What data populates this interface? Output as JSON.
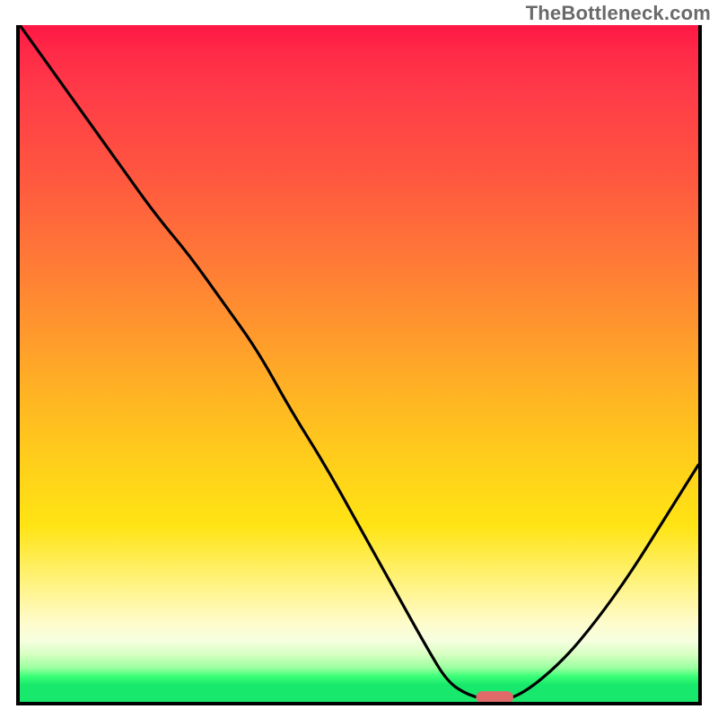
{
  "watermark": "TheBottleneck.com",
  "colors": {
    "curve": "#000000",
    "marker": "#e06a6a",
    "frame": "#000000",
    "gradient_top": "#ff1744",
    "gradient_mid": "#ffd21a",
    "gradient_bottom": "#18e86b"
  },
  "chart_data": {
    "type": "line",
    "title": "",
    "xlabel": "",
    "ylabel": "",
    "xlim": [
      0,
      1
    ],
    "ylim": [
      0,
      1
    ],
    "series": [
      {
        "name": "bottleneck-curve",
        "x": [
          0.0,
          0.05,
          0.1,
          0.15,
          0.2,
          0.25,
          0.3,
          0.35,
          0.4,
          0.45,
          0.5,
          0.55,
          0.6,
          0.63,
          0.66,
          0.7,
          0.74,
          0.8,
          0.85,
          0.9,
          0.95,
          1.0
        ],
        "values": [
          1.0,
          0.93,
          0.86,
          0.79,
          0.72,
          0.66,
          0.59,
          0.52,
          0.43,
          0.35,
          0.26,
          0.17,
          0.08,
          0.03,
          0.01,
          0.0,
          0.01,
          0.06,
          0.12,
          0.19,
          0.27,
          0.35
        ]
      }
    ],
    "annotations": [
      {
        "name": "optimal-marker",
        "x": 0.7,
        "y": 0.0,
        "shape": "pill",
        "color": "#e06a6a"
      }
    ]
  }
}
